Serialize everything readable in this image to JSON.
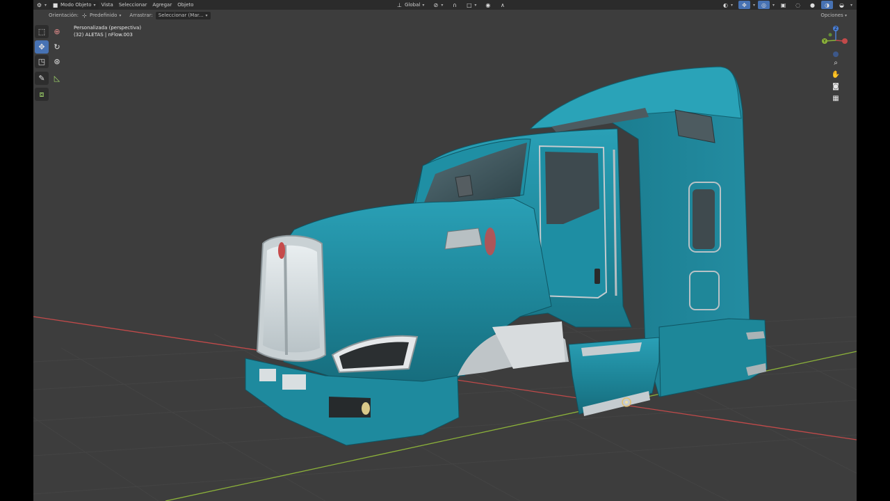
{
  "header": {
    "mode_label": "Modo Objeto",
    "menu": [
      "Vista",
      "Seleccionar",
      "Agregar",
      "Objeto"
    ],
    "pivot_label": "Global",
    "options_label": "Opciones"
  },
  "subheader": {
    "orientation_label": "Orientación:",
    "orientation_value": "Predefinido",
    "drag_label": "Arrastrar:",
    "drag_value": "Seleccionar (Mar..."
  },
  "viewport": {
    "view_name": "Personalizada (perspectiva)",
    "object_info": "(32) ALETAS | nFlow.003"
  },
  "gizmo": {
    "z": "Z",
    "y": "Y"
  },
  "colors": {
    "viewport_bg": "#3d3d3d",
    "header_bg": "#2b2b2b",
    "active_tool": "#4772b3",
    "truck_body": "#1e8a9e",
    "x_axis": "#c24a4a",
    "y_axis": "#8cb23a"
  },
  "icons": {
    "tools": [
      "select-box-icon",
      "cursor-icon",
      "move-icon",
      "rotate-icon",
      "scale-icon",
      "transform-icon",
      "annotate-icon",
      "measure-icon",
      "add-cube-icon"
    ],
    "nav": [
      "zoom-icon",
      "pan-hand-icon",
      "camera-icon",
      "grid-view-icon"
    ]
  }
}
